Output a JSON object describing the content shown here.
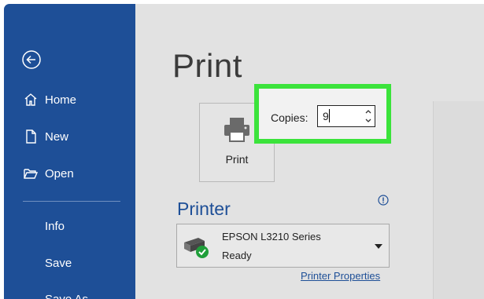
{
  "sidebar": {
    "back_icon": "back-arrow-icon",
    "items": [
      {
        "label": "Home",
        "icon": "home-icon"
      },
      {
        "label": "New",
        "icon": "new-document-icon"
      },
      {
        "label": "Open",
        "icon": "open-folder-icon"
      },
      {
        "label": "Info"
      },
      {
        "label": "Save"
      },
      {
        "label": "Save As"
      }
    ],
    "colors": {
      "background": "#1e4f97",
      "text": "#ffffff"
    }
  },
  "main": {
    "title": "Print",
    "print_button": {
      "label": "Print",
      "icon": "printer-icon"
    },
    "copies": {
      "label": "Copies:",
      "value": "9",
      "highlight_color": "#3be33b"
    },
    "printer_section": {
      "title": "Printer",
      "info_icon": "info-icon",
      "selected_printer": {
        "name": "EPSON L3210 Series",
        "status": "Ready",
        "icon": "printer-ready-icon"
      },
      "properties_link": "Printer Properties"
    }
  }
}
